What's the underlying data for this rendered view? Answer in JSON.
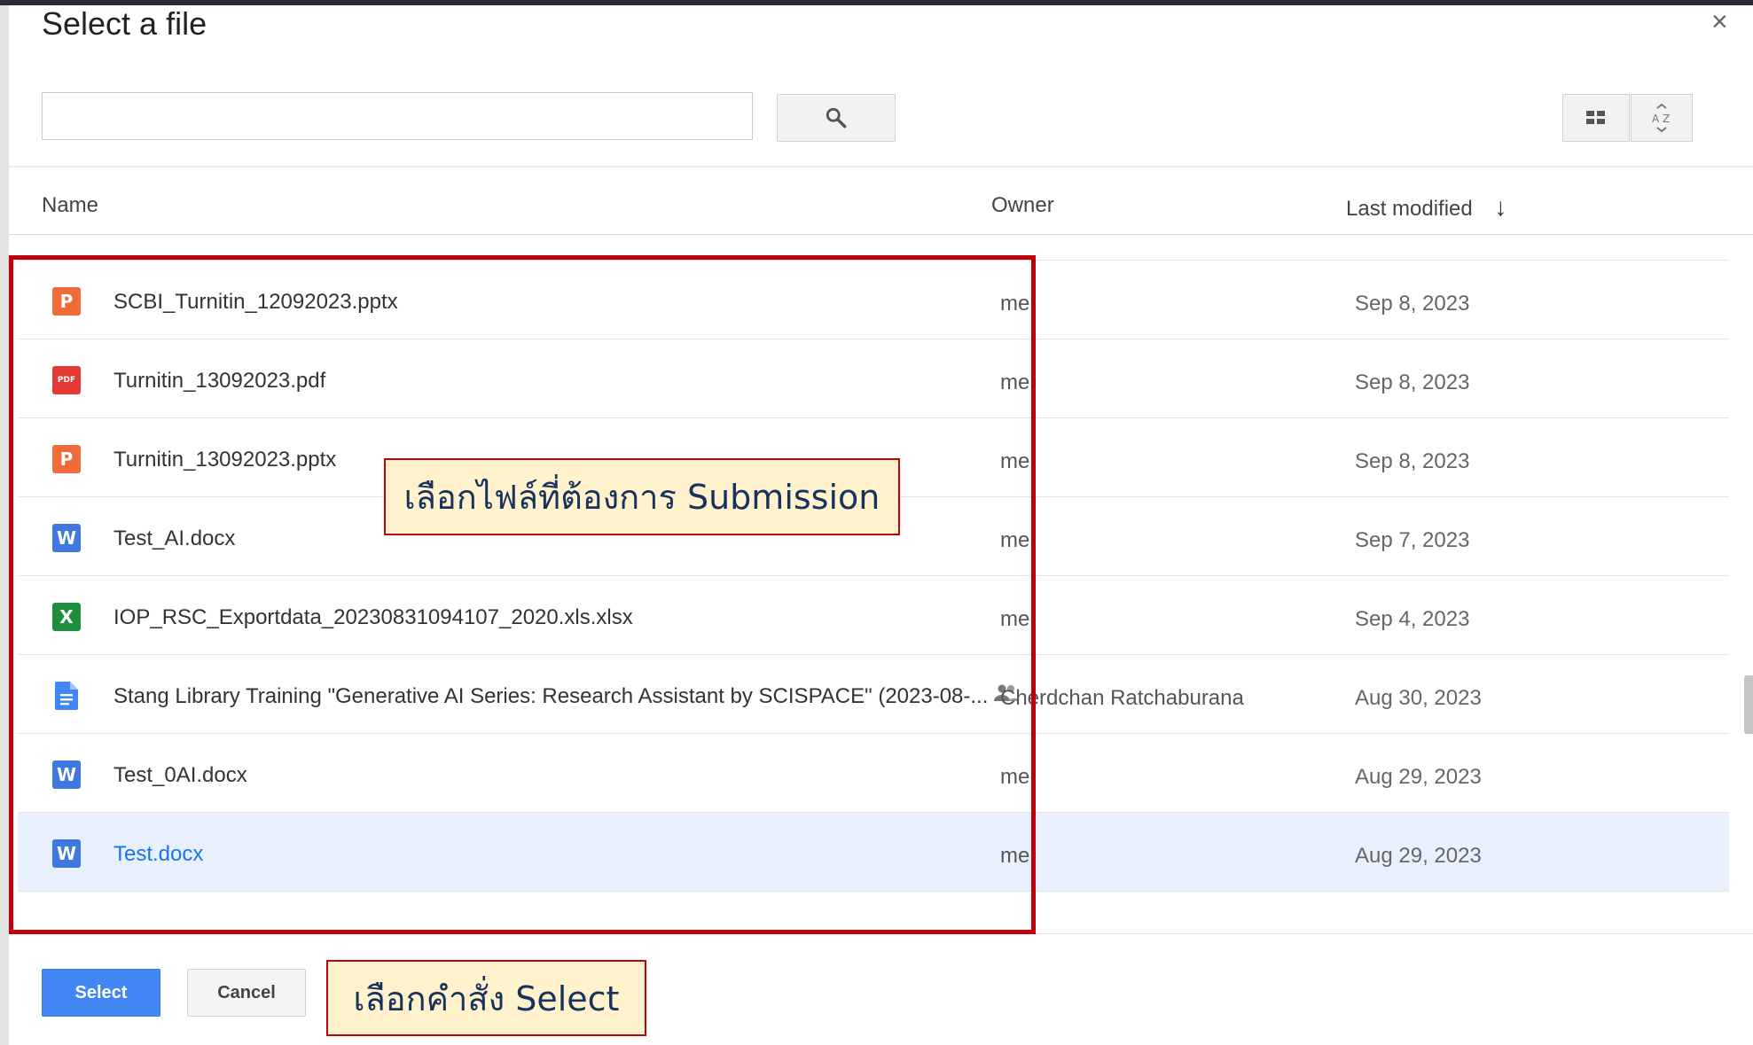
{
  "dialog": {
    "title": "Select a file",
    "close_glyph": "×"
  },
  "search": {
    "value": "",
    "placeholder": ""
  },
  "columns": {
    "name": "Name",
    "owner": "Owner",
    "last_modified": "Last modified",
    "sort_glyph": "↓"
  },
  "files": [
    {
      "name": "SCBI_Turnitin_12092023.pptx",
      "owner": "me",
      "date": "Sep 8, 2023",
      "type": "pptx",
      "icon_letter": "P",
      "color": "#f06b3a"
    },
    {
      "name": "Turnitin_13092023.pdf",
      "owner": "me",
      "date": "Sep 8, 2023",
      "type": "pdf",
      "icon_letter": "PDF",
      "color": "#e53935"
    },
    {
      "name": "Turnitin_13092023.pptx",
      "owner": "me",
      "date": "Sep 8, 2023",
      "type": "pptx",
      "icon_letter": "P",
      "color": "#f06b3a"
    },
    {
      "name": "Test_AI.docx",
      "owner": "me",
      "date": "Sep 7, 2023",
      "type": "docx",
      "icon_letter": "W",
      "color": "#3f78e0"
    },
    {
      "name": "IOP_RSC_Exportdata_20230831094107_2020.xls.xlsx",
      "owner": "me",
      "date": "Sep 4, 2023",
      "type": "xlsx",
      "icon_letter": "X",
      "color": "#1e8e3e"
    },
    {
      "name": "Stang Library Training \"Generative AI Series: Research Assistant by SCISPACE\" (2023-08-...",
      "owner": "Cherdchan Ratchaburana",
      "date": "Aug 30, 2023",
      "type": "gdoc",
      "icon_letter": "",
      "color": "#4285f4",
      "shared": true
    },
    {
      "name": "Test_0AI.docx",
      "owner": "me",
      "date": "Aug 29, 2023",
      "type": "docx",
      "icon_letter": "W",
      "color": "#3f78e0"
    },
    {
      "name": "Test.docx",
      "owner": "me",
      "date": "Aug 29, 2023",
      "type": "docx",
      "icon_letter": "W",
      "color": "#3f78e0",
      "selected": true
    }
  ],
  "footer": {
    "select_label": "Select",
    "cancel_label": "Cancel"
  },
  "annotations": {
    "file_callout": "เลือกไฟล์ที่ต้องการ Submission",
    "select_callout": "เลือกคำสั่ง Select"
  },
  "colors": {
    "accent": "#4285f4",
    "highlight": "#c0000b",
    "callout_bg": "#fff2cc",
    "selected_row": "#e8f0fe"
  }
}
